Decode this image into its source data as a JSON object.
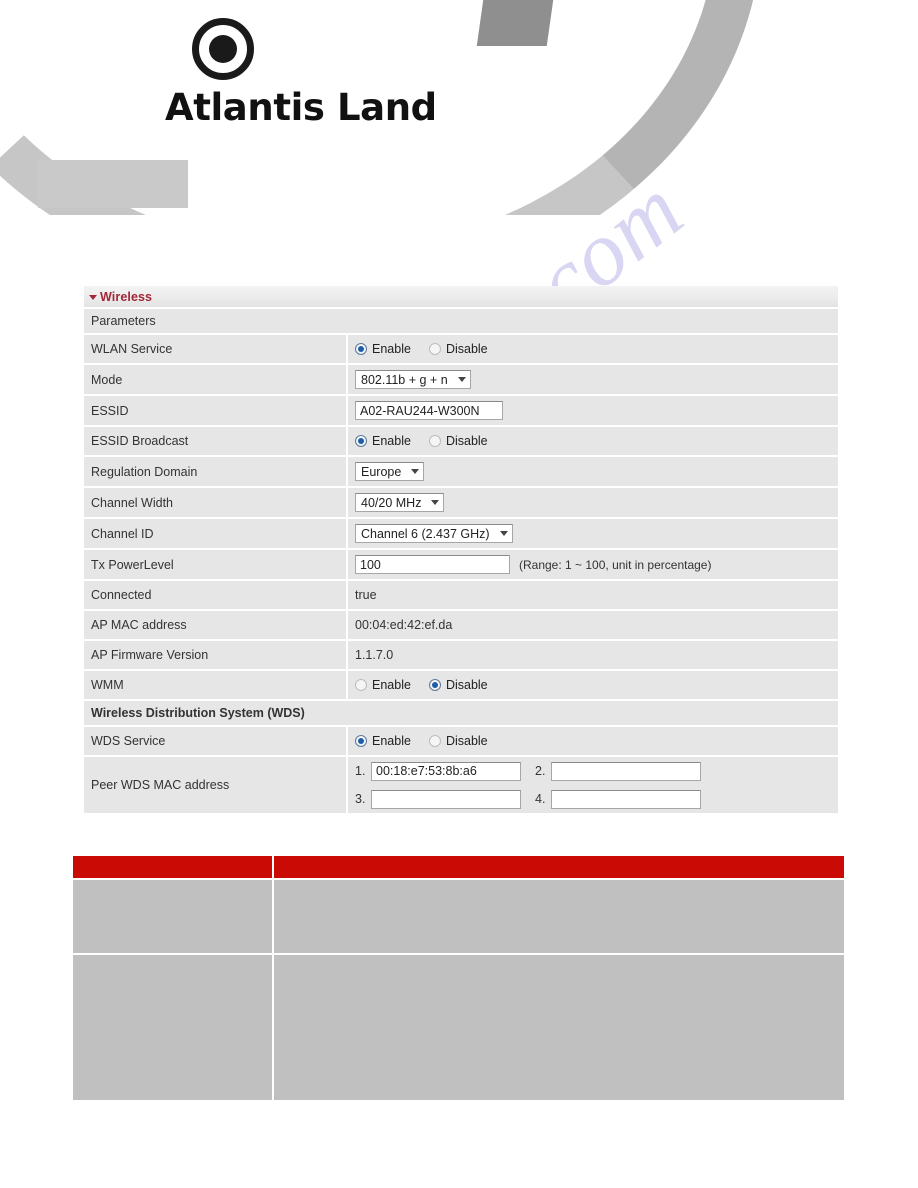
{
  "brand": {
    "logo_text": "Atlantis Land",
    "logo_mark_name": "circle-dot-logo"
  },
  "watermark": {
    "text": "manualshive.com"
  },
  "panel": {
    "title": "Wireless",
    "collapse_icon": "triangle-down-icon",
    "sections": {
      "parameters": "Parameters",
      "wds": "Wireless Distribution System (WDS)"
    },
    "radio_labels": {
      "enable": "Enable",
      "disable": "Disable"
    },
    "rows": {
      "wlan_service": {
        "label": "WLAN Service",
        "selected": "Enable"
      },
      "mode": {
        "label": "Mode",
        "value": "802.11b + g + n"
      },
      "essid": {
        "label": "ESSID",
        "value": "A02-RAU244-W300N"
      },
      "essid_broadcast": {
        "label": "ESSID Broadcast",
        "selected": "Enable"
      },
      "regulation_domain": {
        "label": "Regulation Domain",
        "value": "Europe"
      },
      "channel_width": {
        "label": "Channel Width",
        "value": "40/20 MHz"
      },
      "channel_id": {
        "label": "Channel ID",
        "value": "Channel 6 (2.437 GHz)"
      },
      "tx_power_level": {
        "label": "Tx PowerLevel",
        "value": "100",
        "hint": "(Range: 1 ~ 100, unit in percentage)"
      },
      "connected": {
        "label": "Connected",
        "value": "true"
      },
      "ap_mac_address": {
        "label": "AP MAC address",
        "value": "00:04:ed:42:ef.da"
      },
      "ap_firmware_version": {
        "label": "AP Firmware Version",
        "value": "1.1.7.0"
      },
      "wmm": {
        "label": "WMM",
        "selected": "Disable"
      },
      "wds_service": {
        "label": "WDS Service",
        "selected": "Enable"
      },
      "peer_wds_mac": {
        "label": "Peer WDS MAC address",
        "entries": [
          {
            "index": "1.",
            "value": "00:18:e7:53:8b:a6"
          },
          {
            "index": "2.",
            "value": ""
          },
          {
            "index": "3.",
            "value": ""
          },
          {
            "index": "4.",
            "value": ""
          }
        ]
      }
    }
  },
  "description_table": {
    "header": {
      "col_a": "",
      "col_b": ""
    },
    "rows": [
      {
        "col_a": "",
        "col_b": ""
      },
      {
        "col_a": "",
        "col_b": ""
      }
    ]
  },
  "colors": {
    "brand_red": "#a32638",
    "table_header_red": "#c90a05",
    "table_body_gray": "#c0c0c0",
    "row_gray": "#e6e6e6",
    "radio_blue": "#1c5ea8"
  }
}
